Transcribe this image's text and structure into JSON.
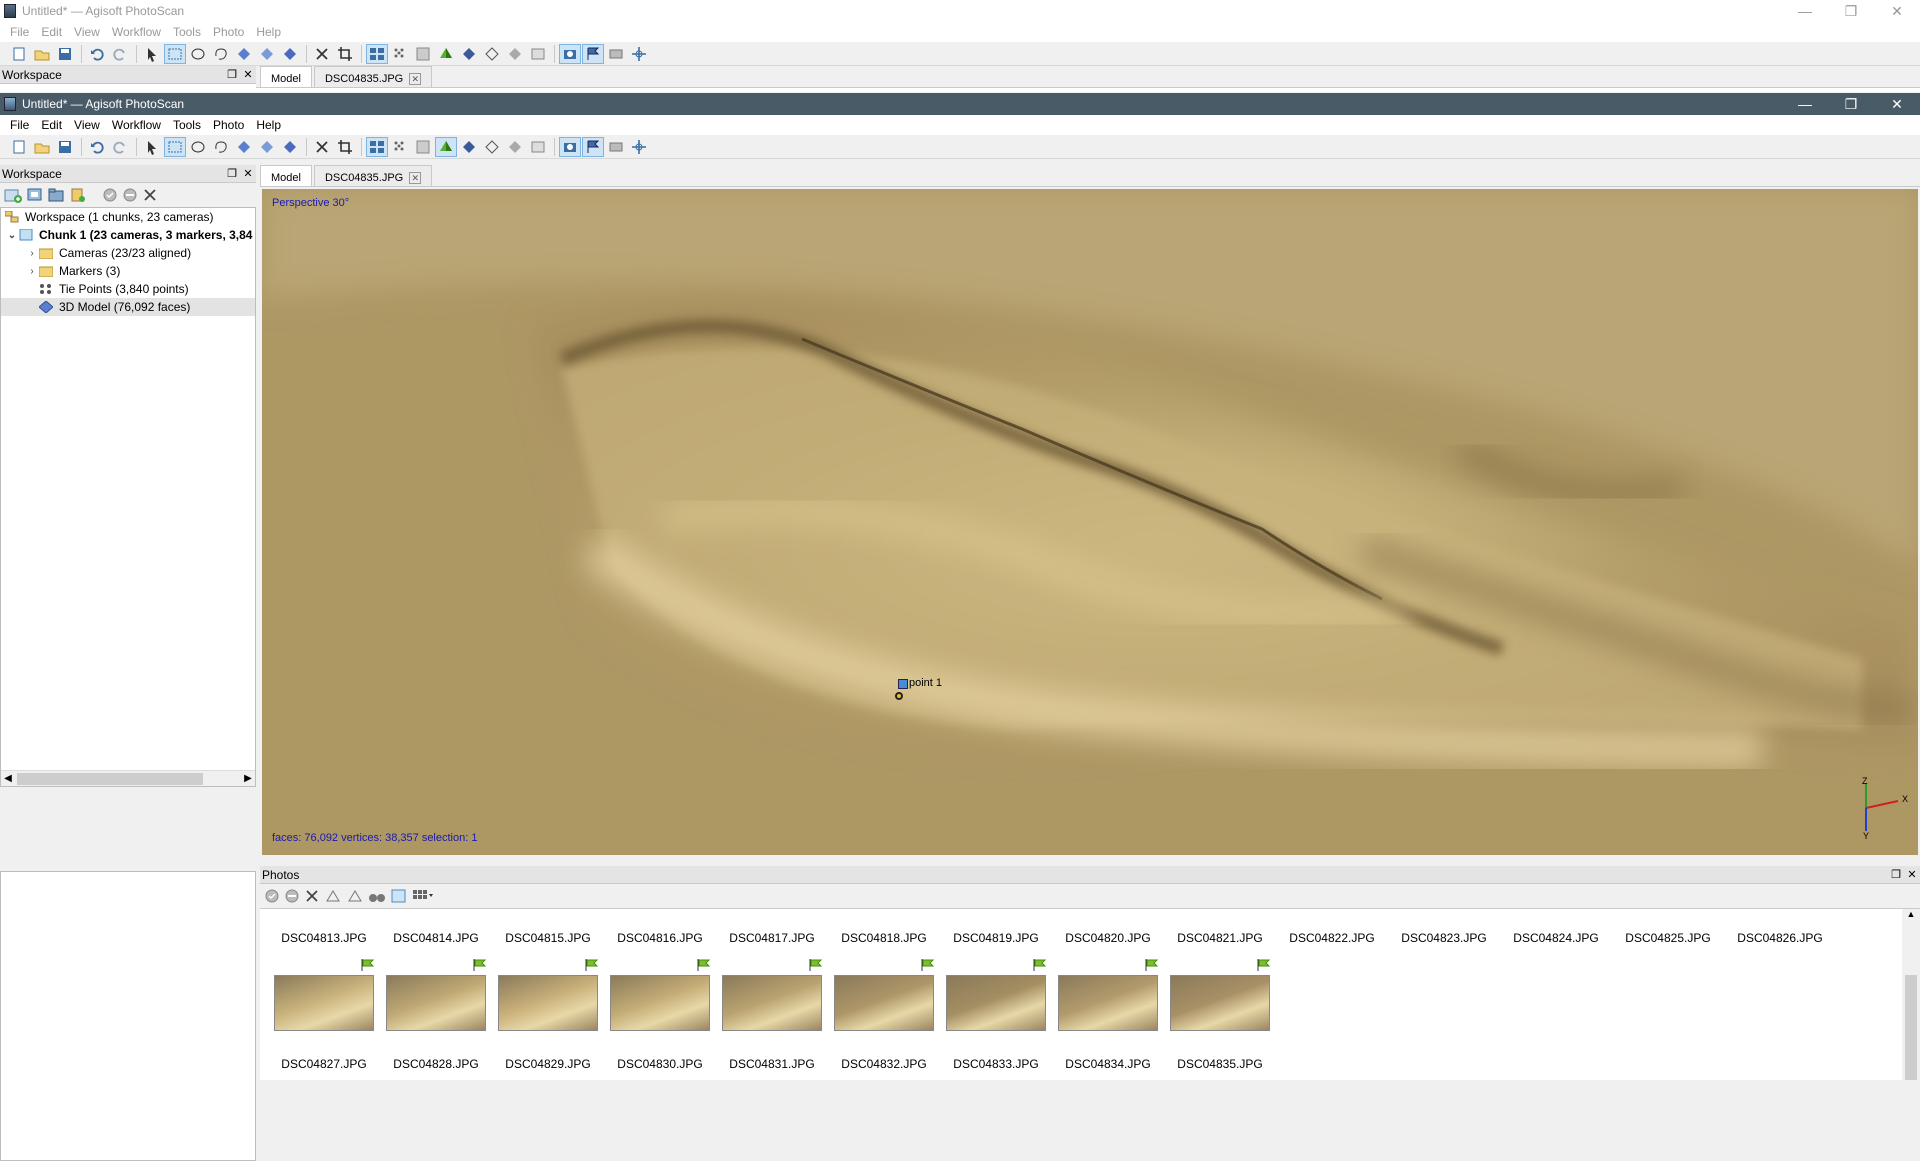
{
  "bg_window": {
    "title": "Untitled* — Agisoft PhotoScan",
    "menu": [
      "File",
      "Edit",
      "View",
      "Workflow",
      "Tools",
      "Photo",
      "Help"
    ],
    "workspace_label": "Workspace",
    "tabs": [
      "Model",
      "DSC04835.JPG"
    ]
  },
  "window": {
    "title": "Untitled* — Agisoft PhotoScan",
    "menu": [
      "File",
      "Edit",
      "View",
      "Workflow",
      "Tools",
      "Photo",
      "Help"
    ]
  },
  "workspace": {
    "label": "Workspace",
    "tree": [
      {
        "label": "Workspace (1 chunks, 23 cameras)",
        "level": 0
      },
      {
        "label": "Chunk 1 (23 cameras, 3 markers, 3,84",
        "level": 1,
        "bold": true
      },
      {
        "label": "Cameras (23/23 aligned)",
        "level": 2
      },
      {
        "label": "Markers (3)",
        "level": 2
      },
      {
        "label": "Tie Points (3,840 points)",
        "level": 2
      },
      {
        "label": "3D Model (76,092 faces)",
        "level": 2,
        "selected": true
      }
    ]
  },
  "model_view": {
    "tabs": [
      "Model",
      "DSC04835.JPG"
    ],
    "perspective": "Perspective 30°",
    "marker_label": "point 1",
    "stats": "faces: 76,092 vertices: 38,357 selection: 1",
    "axes": {
      "x": "X",
      "y": "Y",
      "z": "Z"
    }
  },
  "photos": {
    "label": "Photos",
    "row1": [
      "DSC04813.JPG",
      "DSC04814.JPG",
      "DSC04815.JPG",
      "DSC04816.JPG",
      "DSC04817.JPG",
      "DSC04818.JPG",
      "DSC04819.JPG",
      "DSC04820.JPG",
      "DSC04821.JPG",
      "DSC04822.JPG",
      "DSC04823.JPG",
      "DSC04824.JPG",
      "DSC04825.JPG",
      "DSC04826.JPG"
    ],
    "row2": [
      "DSC04827.JPG",
      "DSC04828.JPG",
      "DSC04829.JPG",
      "DSC04830.JPG",
      "DSC04831.JPG",
      "DSC04832.JPG",
      "DSC04833.JPG",
      "DSC04834.JPG",
      "DSC04835.JPG"
    ]
  },
  "colors": {
    "accent": "#3a7bd5",
    "selection": "#cde4f7",
    "model": "#b8a06a",
    "stats_text": "#1a1ab0"
  }
}
